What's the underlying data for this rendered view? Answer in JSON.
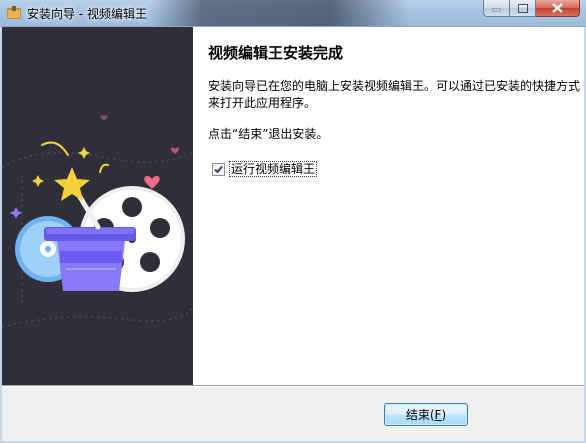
{
  "window": {
    "title": "安装向导 - 视频编辑王",
    "buttons": {
      "minimize": "minimize-icon",
      "maximize": "maximize-icon",
      "close": "close-icon"
    }
  },
  "content": {
    "heading": "视频编辑王安装完成",
    "paragraph1": "安装向导已在您的电脑上安装视频编辑王。可以通过已安装的快捷方式来打开此应用程序。",
    "paragraph2": "点击“结束”退出安装。",
    "run_checkbox": {
      "label": "运行视频编辑王",
      "checked": true
    }
  },
  "footer": {
    "finish_label": "结束(",
    "finish_hotkey": "F",
    "finish_suffix": ")"
  },
  "colors": {
    "sidebar_bg": "#2f2e3a",
    "accent_purple": "#7b6cf6",
    "star_yellow": "#f6d23a",
    "heart_pink": "#f06b8a"
  }
}
